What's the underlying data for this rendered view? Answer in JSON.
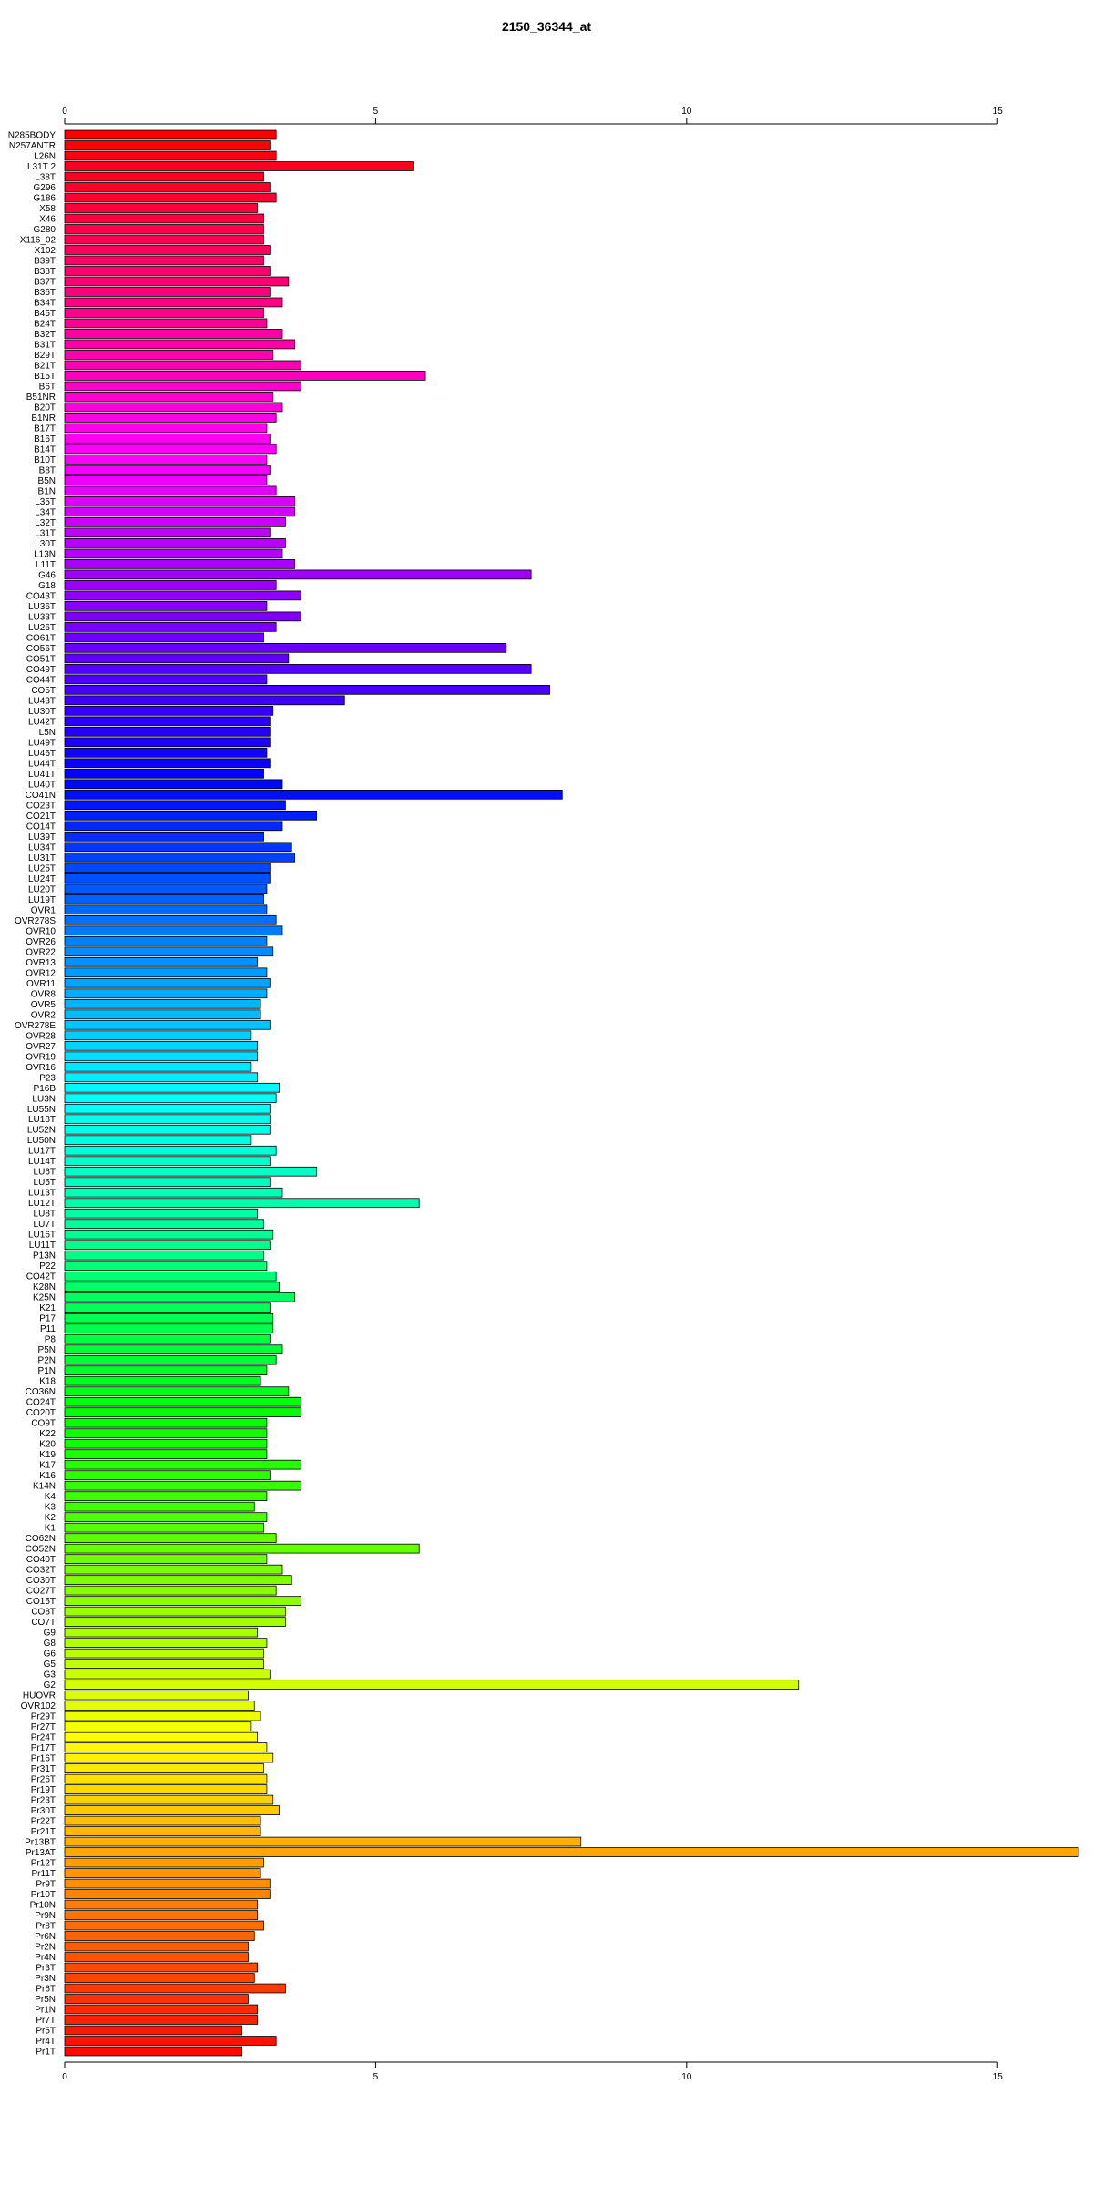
{
  "chart_data": {
    "type": "bar",
    "orientation": "horizontal",
    "title": "2150_36344_at",
    "xlabel": "",
    "ylabel": "",
    "xlim": [
      0,
      16.3
    ],
    "xticks": [
      0,
      5,
      10,
      15
    ],
    "xtick_labels": [
      "0",
      "5",
      "10",
      "15"
    ],
    "axes": [
      "top",
      "bottom"
    ],
    "grid": false,
    "legend": "none",
    "bar_colors": "rainbow gradient from red through magenta, purple, blue, cyan, green, yellow, orange back to red",
    "categories": [
      "N285BODY",
      "N257ANTR",
      "L26N",
      "L31T 2",
      "L38T",
      "G296",
      "G186",
      "X58",
      "X46",
      "G280",
      "X116_02",
      "X102",
      "B39T",
      "B38T",
      "B37T",
      "B36T",
      "B34T",
      "B45T",
      "B24T",
      "B32T",
      "B31T",
      "B29T",
      "B21T",
      "B15T",
      "B6T",
      "B51NR",
      "B20T",
      "B1NR",
      "B17T",
      "B16T",
      "B14T",
      "B10T",
      "B8T",
      "B5N",
      "B1N",
      "L35T",
      "L34T",
      "L32T",
      "L31T",
      "L30T",
      "L13N",
      "L11T",
      "G46",
      "G18",
      "CO43T",
      "LU36T",
      "LU33T",
      "LU26T",
      "CO61T",
      "CO56T",
      "CO51T",
      "CO49T",
      "CO44T",
      "CO5T",
      "LU43T",
      "LU30T",
      "LU42T",
      "L5N",
      "LU49T",
      "LU46T",
      "LU44T",
      "LU41T",
      "LU40T",
      "CO41N",
      "CO23T",
      "CO21T",
      "CO14T",
      "LU39T",
      "LU34T",
      "LU31T",
      "LU25T",
      "LU24T",
      "LU20T",
      "LU19T",
      "OVR1",
      "OVR278S",
      "OVR10",
      "OVR26",
      "OVR22",
      "OVR13",
      "OVR12",
      "OVR11",
      "OVR8",
      "OVR5",
      "OVR2",
      "OVR278E",
      "OVR28",
      "OVR27",
      "OVR19",
      "OVR16",
      "P23",
      "P16B",
      "LU3N",
      "LU55N",
      "LU18T",
      "LU52N",
      "LU50N",
      "LU17T",
      "LU14T",
      "LU6T",
      "LU5T",
      "LU13T",
      "LU12T",
      "LU8T",
      "LU7T",
      "LU16T",
      "LU11T",
      "P13N",
      "P22",
      "CO42T",
      "K28N",
      "K25N",
      "K21",
      "P17",
      "P11",
      "P8",
      "P5N",
      "P2N",
      "P1N",
      "K18",
      "CO36N",
      "CO24T",
      "CO20T",
      "CO9T",
      "K22",
      "K20",
      "K19",
      "K17",
      "K16",
      "K14N",
      "K4",
      "K3",
      "K2",
      "K1",
      "CO62N",
      "CO52N",
      "CO40T",
      "CO32T",
      "CO30T",
      "CO27T",
      "CO15T",
      "CO8T",
      "CO7T",
      "G9",
      "G8",
      "G6",
      "G5",
      "G3",
      "G2",
      "HUOVR",
      "OVR102",
      "Pr29T",
      "Pr27T",
      "Pr24T",
      "Pr17T",
      "Pr16T",
      "Pr31T",
      "Pr26T",
      "Pr19T",
      "Pr23T",
      "Pr30T",
      "Pr22T",
      "Pr21T",
      "Pr13BT",
      "Pr13AT",
      "Pr12T",
      "Pr11T",
      "Pr9T",
      "Pr10T",
      "Pr10N",
      "Pr9N",
      "Pr8T",
      "Pr6N",
      "Pr2N",
      "Pr4N",
      "Pr3T",
      "Pr3N",
      "Pr6T",
      "Pr5N",
      "Pr1N",
      "Pr7T",
      "Pr5T",
      "Pr4T",
      "Pr1T"
    ],
    "values": [
      3.4,
      3.3,
      3.4,
      5.6,
      3.2,
      3.3,
      3.4,
      3.1,
      3.2,
      3.2,
      3.2,
      3.3,
      3.2,
      3.3,
      3.6,
      3.3,
      3.5,
      3.2,
      3.25,
      3.5,
      3.7,
      3.35,
      3.8,
      5.8,
      3.8,
      3.35,
      3.5,
      3.4,
      3.25,
      3.3,
      3.4,
      3.25,
      3.3,
      3.25,
      3.4,
      3.7,
      3.7,
      3.55,
      3.3,
      3.55,
      3.5,
      3.7,
      7.5,
      3.4,
      3.8,
      3.25,
      3.8,
      3.4,
      3.2,
      7.1,
      3.6,
      7.5,
      3.25,
      7.8,
      4.5,
      3.35,
      3.3,
      3.3,
      3.3,
      3.25,
      3.3,
      3.2,
      3.5,
      8.0,
      3.55,
      4.05,
      3.5,
      3.2,
      3.65,
      3.7,
      3.3,
      3.3,
      3.25,
      3.2,
      3.25,
      3.4,
      3.5,
      3.25,
      3.35,
      3.1,
      3.25,
      3.3,
      3.25,
      3.15,
      3.15,
      3.3,
      3.0,
      3.1,
      3.1,
      3.0,
      3.1,
      3.45,
      3.4,
      3.3,
      3.3,
      3.3,
      3.0,
      3.4,
      3.3,
      4.05,
      3.3,
      3.5,
      5.7,
      3.1,
      3.2,
      3.35,
      3.3,
      3.2,
      3.25,
      3.4,
      3.45,
      3.7,
      3.3,
      3.35,
      3.35,
      3.3,
      3.5,
      3.4,
      3.25,
      3.15,
      3.6,
      3.8,
      3.8,
      3.25,
      3.25,
      3.25,
      3.25,
      3.8,
      3.3,
      3.8,
      3.25,
      3.05,
      3.25,
      3.2,
      3.4,
      5.7,
      3.25,
      3.5,
      3.65,
      3.4,
      3.8,
      3.55,
      3.55,
      3.1,
      3.25,
      3.2,
      3.2,
      3.3,
      11.8,
      2.95,
      3.05,
      3.15,
      3.0,
      3.1,
      3.25,
      3.35,
      3.2,
      3.25,
      3.25,
      3.35,
      3.45,
      3.15,
      3.15,
      8.3,
      16.3,
      3.2,
      3.15,
      3.3,
      3.3,
      3.1,
      3.1,
      3.2,
      3.05,
      2.95,
      2.95,
      3.1,
      3.05,
      3.55,
      2.95,
      3.1,
      3.1,
      2.85,
      3.4,
      2.85
    ]
  }
}
